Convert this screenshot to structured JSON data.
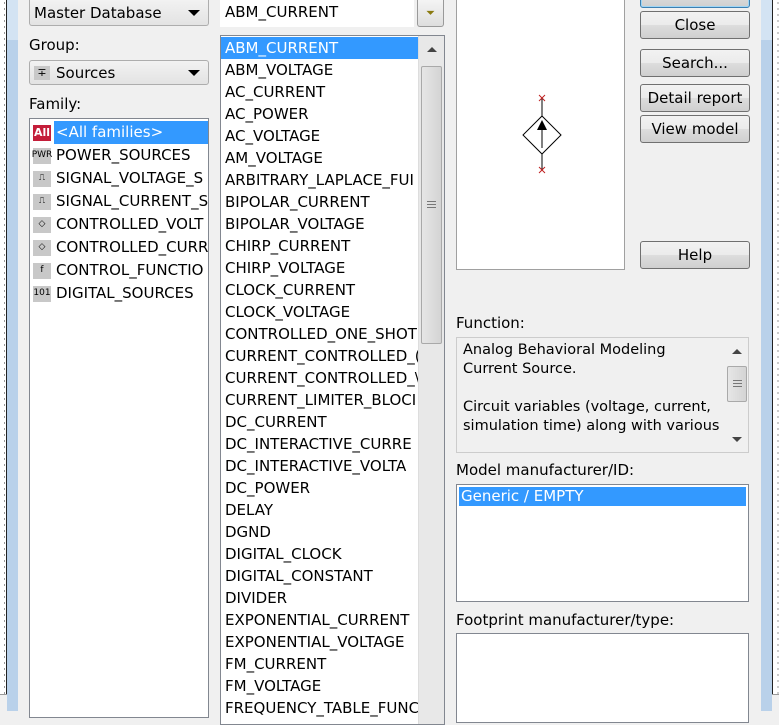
{
  "database": {
    "selected": "Master Database"
  },
  "group": {
    "label": "Group:",
    "selected": "Sources",
    "icon": "sources-icon"
  },
  "family": {
    "label": "Family:",
    "items": [
      {
        "icon": "All",
        "icon_name": "all-families-icon",
        "label": "<All families>",
        "selected": true
      },
      {
        "icon": "PWR",
        "icon_name": "power-sources-icon",
        "label": "POWER_SOURCES"
      },
      {
        "icon": "⎍",
        "icon_name": "signal-voltage-icon",
        "label": "SIGNAL_VOLTAGE_S"
      },
      {
        "icon": "⎍",
        "icon_name": "signal-current-icon",
        "label": "SIGNAL_CURRENT_S"
      },
      {
        "icon": "◇",
        "icon_name": "controlled-voltage-icon",
        "label": "CONTROLLED_VOLT"
      },
      {
        "icon": "◇",
        "icon_name": "controlled-current-icon",
        "label": "CONTROLLED_CURR"
      },
      {
        "icon": "f",
        "icon_name": "control-function-icon",
        "label": "CONTROL_FUNCTIO"
      },
      {
        "icon": "101",
        "icon_name": "digital-sources-icon",
        "label": "DIGITAL_SOURCES"
      }
    ]
  },
  "component": {
    "value": "ABM_CURRENT",
    "items": [
      "ABM_CURRENT",
      "ABM_VOLTAGE",
      "AC_CURRENT",
      "AC_POWER",
      "AC_VOLTAGE",
      "AM_VOLTAGE",
      "ARBITRARY_LAPLACE_FUI",
      "BIPOLAR_CURRENT",
      "BIPOLAR_VOLTAGE",
      "CHIRP_CURRENT",
      "CHIRP_VOLTAGE",
      "CLOCK_CURRENT",
      "CLOCK_VOLTAGE",
      "CONTROLLED_ONE_SHOT",
      "CURRENT_CONTROLLED_(",
      "CURRENT_CONTROLLED_\\",
      "CURRENT_LIMITER_BLOCI",
      "DC_CURRENT",
      "DC_INTERACTIVE_CURRE",
      "DC_INTERACTIVE_VOLTA",
      "DC_POWER",
      "DELAY",
      "DGND",
      "DIGITAL_CLOCK",
      "DIGITAL_CONSTANT",
      "DIVIDER",
      "EXPONENTIAL_CURRENT",
      "EXPONENTIAL_VOLTAGE",
      "FM_CURRENT",
      "FM_VOLTAGE",
      "FREQUENCY_TABLE_FUNC"
    ],
    "selected_index": 0
  },
  "buttons": {
    "ok": "",
    "close": "Close",
    "search": "Search...",
    "detail_report": "Detail report",
    "view_model": "View model",
    "help": "Help"
  },
  "function": {
    "label": "Function:",
    "text": "Analog Behavioral Modeling\nCurrent Source.\n\nCircuit variables (voltage, current,\nsimulation time) along with various"
  },
  "model": {
    "label": "Model manufacturer/ID:",
    "items": [
      "Generic / EMPTY"
    ]
  },
  "footprint": {
    "label": "Footprint manufacturer/type:",
    "items": []
  },
  "colors": {
    "selection": "#3399ff",
    "all_badge": "#c41e3a",
    "window_border": "#b9d1ea"
  }
}
